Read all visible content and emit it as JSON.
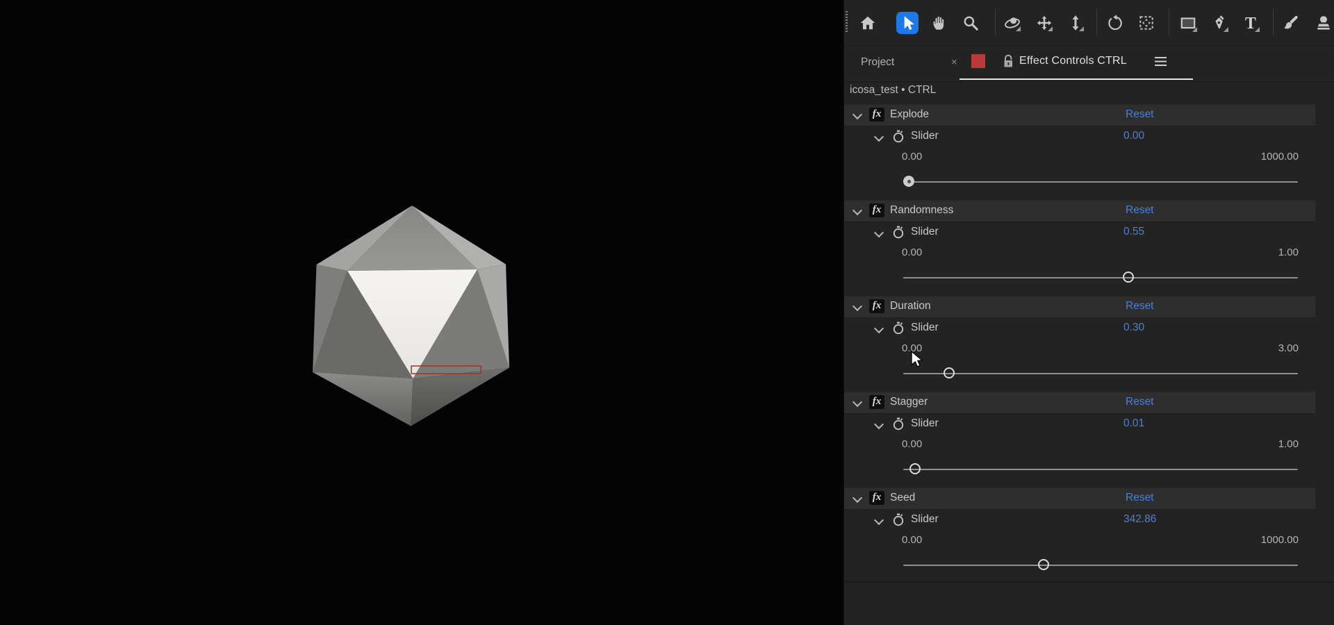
{
  "window": {
    "app": "After Effects",
    "panel": "Effect Controls"
  },
  "toolbar": {
    "active_tool": "selection",
    "tools": [
      "home-icon",
      "selection-icon",
      "hand-icon",
      "zoom-icon",
      "orbit-camera-icon",
      "pan-camera-icon",
      "dolly-camera-icon",
      "rotate-icon",
      "camera-bounds-icon",
      "rectangle-icon",
      "pen-icon",
      "type-icon",
      "brush-icon",
      "clone-stamp-icon"
    ]
  },
  "tab_bar": {
    "project_tab": "Project",
    "project_close": "×",
    "swatch_color": "#b93a36",
    "lock_icon": "lock-open-icon",
    "active_tab": "Effect Controls CTRL",
    "panel_menu_icon": "hamburger-menu-icon"
  },
  "composition_line": "icosa_test • CTRL",
  "misc": {
    "fx_label": "fx"
  },
  "effects": [
    {
      "name": "Explode",
      "reset": "Reset",
      "param": "Slider",
      "value": "0.00",
      "min_label": "0.00",
      "max_label": "1000.00",
      "value_num": 0,
      "min_num": 0,
      "max_num": 1000
    },
    {
      "name": "Randomness",
      "reset": "Reset",
      "param": "Slider",
      "value": "0.55",
      "min_label": "0.00",
      "max_label": "1.00",
      "value_num": 0.57,
      "min_num": 0,
      "max_num": 1
    },
    {
      "name": "Duration",
      "reset": "Reset",
      "param": "Slider",
      "value": "0.30",
      "min_label": "0.00",
      "max_label": "3.00",
      "value_num": 0.35,
      "min_num": 0,
      "max_num": 3
    },
    {
      "name": "Stagger",
      "reset": "Reset",
      "param": "Slider",
      "value": "0.01",
      "min_label": "0.00",
      "max_label": "1.00",
      "value_num": 0.015,
      "min_num": 0,
      "max_num": 1
    },
    {
      "name": "Seed",
      "reset": "Reset",
      "param": "Slider",
      "value": "342.86",
      "min_label": "0.00",
      "max_label": "1000.00",
      "value_num": 355,
      "min_num": 0,
      "max_num": 1000
    }
  ],
  "scene": {
    "object": "icosahedron",
    "annotation": "red-selection-rectangle",
    "annotation_color": "#9c3428"
  },
  "colors": {
    "accent_blue": "#4c80d4",
    "tool_active_bg": "#1b79e8",
    "panel_bg": "#232323",
    "row_bg": "#2e2e2e"
  }
}
